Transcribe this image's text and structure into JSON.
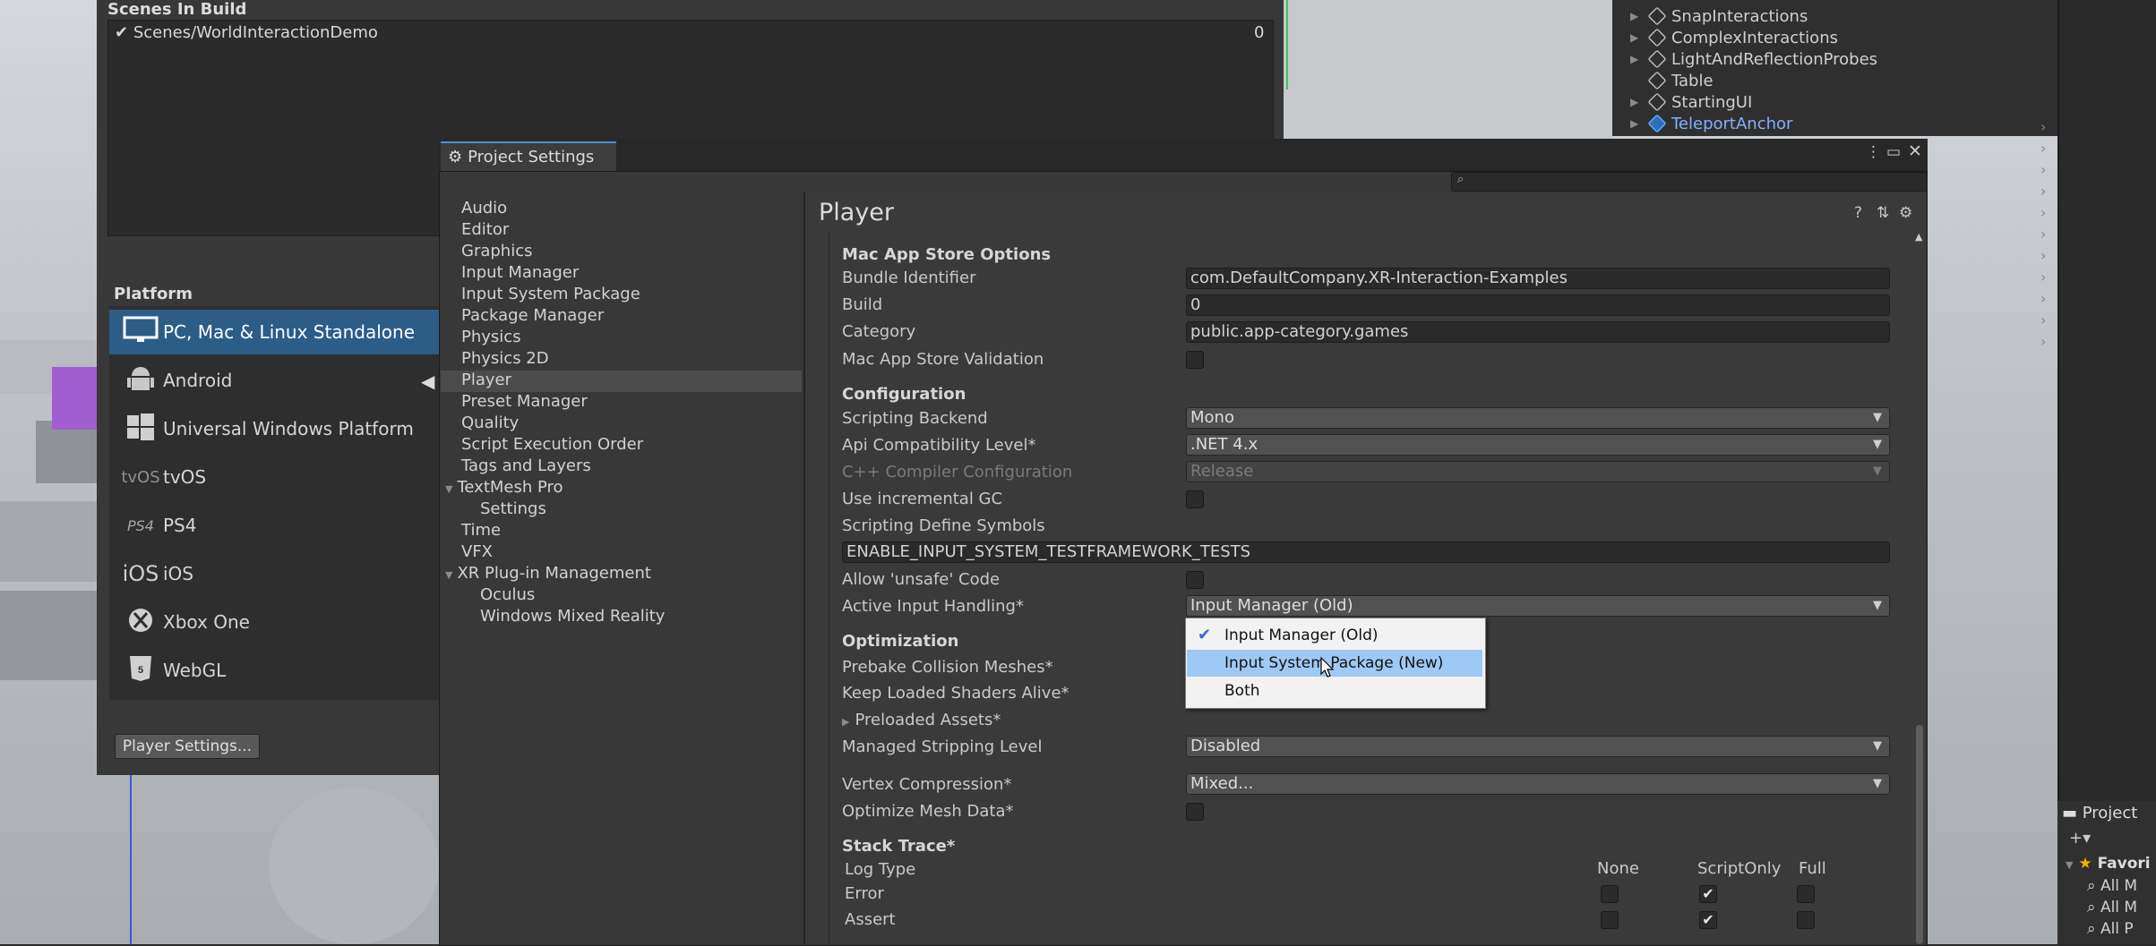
{
  "hierarchy": {
    "items": [
      {
        "label": "SnapInteractions",
        "has_children": true
      },
      {
        "label": "ComplexInteractions",
        "has_children": true
      },
      {
        "label": "LightAndReflectionProbes",
        "has_children": true
      },
      {
        "label": "Table",
        "has_children": false
      },
      {
        "label": "StartingUI",
        "has_children": true
      },
      {
        "label": "TeleportAnchor",
        "has_children": true,
        "selected": true
      }
    ]
  },
  "build": {
    "scenes_header": "Scenes In Build",
    "scene_entry": "Scenes/WorldInteractionDemo",
    "scene_index": "0",
    "platform_header": "Platform",
    "platforms": [
      {
        "label": "PC, Mac & Linux Standalone",
        "icon": "monitor-icon",
        "selected": true
      },
      {
        "label": "Android",
        "icon": "android-icon"
      },
      {
        "label": "Universal Windows Platform",
        "icon": "windows-icon"
      },
      {
        "label": "tvOS",
        "icon": "tvos-icon",
        "icon_text": "tvOS"
      },
      {
        "label": "PS4",
        "icon": "ps4-icon",
        "icon_text": "PS4"
      },
      {
        "label": "iOS",
        "icon": "ios-icon",
        "icon_text": "iOS"
      },
      {
        "label": "Xbox One",
        "icon": "xbox-icon"
      },
      {
        "label": "WebGL",
        "icon": "html5-icon"
      }
    ],
    "player_settings_button": "Player Settings..."
  },
  "project_settings": {
    "tab_label": "Project Settings",
    "nav": [
      "Audio",
      "Editor",
      "Graphics",
      "Input Manager",
      "Input System Package",
      "Package Manager",
      "Physics",
      "Physics 2D",
      "Player",
      "Preset Manager",
      "Quality",
      "Script Execution Order",
      "Tags and Layers",
      "TextMesh Pro",
      "Settings",
      "Time",
      "VFX",
      "XR Plug-in Management",
      "Oculus",
      "Windows Mixed Reality"
    ],
    "selected_nav": "Player",
    "title": "Player",
    "mac_app_store": {
      "header": "Mac App Store Options",
      "bundle_identifier_label": "Bundle Identifier",
      "bundle_identifier": "com.DefaultCompany.XR-Interaction-Examples",
      "build_label": "Build",
      "build": "0",
      "category_label": "Category",
      "category": "public.app-category.games",
      "validation_label": "Mac App Store Validation"
    },
    "configuration": {
      "header": "Configuration",
      "scripting_backend_label": "Scripting Backend",
      "scripting_backend": "Mono",
      "api_level_label": "Api Compatibility Level*",
      "api_level": ".NET 4.x",
      "cpp_config_label": "C++ Compiler Configuration",
      "cpp_config": "Release",
      "incremental_gc_label": "Use incremental GC",
      "define_symbols_label": "Scripting Define Symbols",
      "define_symbols": "ENABLE_INPUT_SYSTEM_TESTFRAMEWORK_TESTS",
      "unsafe_label": "Allow 'unsafe' Code",
      "input_handling_label": "Active Input Handling*",
      "input_handling": "Input Manager (Old)"
    },
    "input_handling_options": [
      {
        "label": "Input Manager (Old)",
        "checked": true
      },
      {
        "label": "Input System Package (New)",
        "highlighted": true
      },
      {
        "label": "Both"
      }
    ],
    "optimization": {
      "header": "Optimization",
      "prebake_label": "Prebake Collision Meshes*",
      "keep_shaders_label": "Keep Loaded Shaders Alive*",
      "preloaded_label": "Preloaded Assets*",
      "stripping_label": "Managed Stripping Level",
      "stripping": "Disabled",
      "vertex_label": "Vertex Compression*",
      "vertex": "Mixed...",
      "optimize_mesh_label": "Optimize Mesh Data*"
    },
    "stack_trace": {
      "header": "Stack Trace*",
      "log_type_label": "Log Type",
      "columns": [
        "None",
        "ScriptOnly",
        "Full"
      ],
      "rows": [
        {
          "label": "Error",
          "checks": [
            false,
            true,
            false
          ]
        },
        {
          "label": "Assert",
          "checks": [
            false,
            true,
            false
          ]
        }
      ]
    }
  },
  "project_panel": {
    "tab_label": "Project",
    "favorites_label": "Favori",
    "items": [
      "All M",
      "All M",
      "All P"
    ]
  }
}
